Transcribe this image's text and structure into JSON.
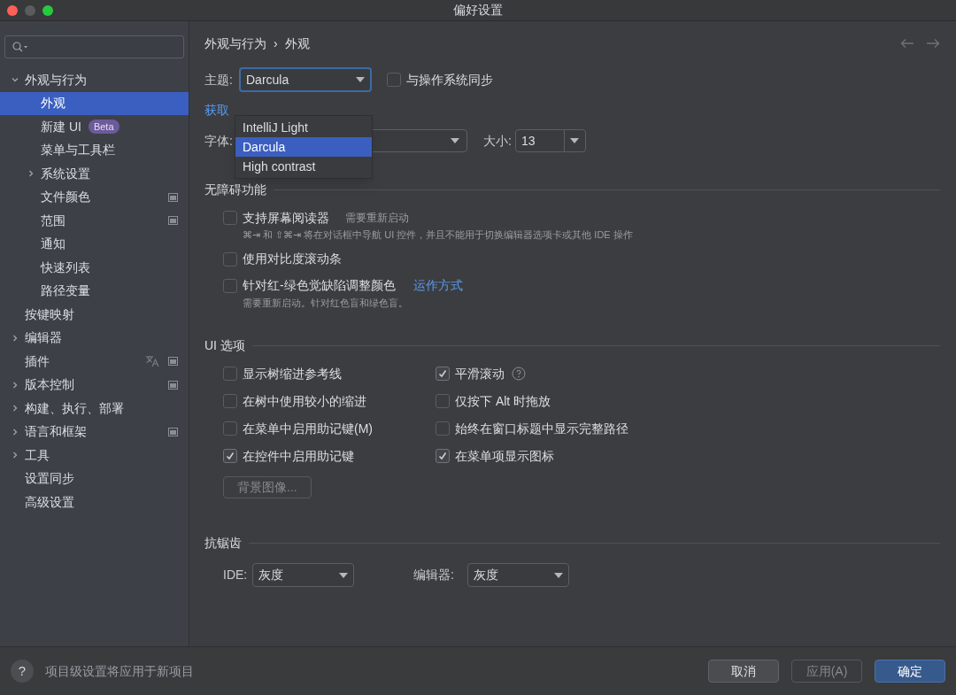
{
  "window": {
    "title": "偏好设置"
  },
  "sidebar": {
    "items": [
      {
        "label": "外观与行为",
        "selected": false,
        "expanded": true,
        "project_icon": false,
        "translate_icon": false,
        "children": [
          {
            "label": "外观",
            "selected": true,
            "project_icon": false,
            "translate_icon": false
          },
          {
            "label": "新建 UI",
            "badge": "Beta",
            "selected": false,
            "project_icon": false,
            "translate_icon": false
          },
          {
            "label": "菜单与工具栏",
            "selected": false,
            "project_icon": false,
            "translate_icon": false
          },
          {
            "label": "系统设置",
            "selected": false,
            "expanded": false,
            "project_icon": false,
            "translate_icon": false
          },
          {
            "label": "文件颜色",
            "selected": false,
            "project_icon": true,
            "translate_icon": false
          },
          {
            "label": "范围",
            "selected": false,
            "project_icon": true,
            "translate_icon": false
          },
          {
            "label": "通知",
            "selected": false,
            "project_icon": false,
            "translate_icon": false
          },
          {
            "label": "快速列表",
            "selected": false,
            "project_icon": false,
            "translate_icon": false
          },
          {
            "label": "路径变量",
            "selected": false,
            "project_icon": false,
            "translate_icon": false
          }
        ]
      },
      {
        "label": "按键映射",
        "selected": false,
        "project_icon": false,
        "translate_icon": false
      },
      {
        "label": "编辑器",
        "selected": false,
        "expanded": false,
        "project_icon": false,
        "translate_icon": false
      },
      {
        "label": "插件",
        "selected": false,
        "project_icon": true,
        "translate_icon": true
      },
      {
        "label": "版本控制",
        "selected": false,
        "expanded": false,
        "project_icon": true,
        "translate_icon": false
      },
      {
        "label": "构建、执行、部署",
        "selected": false,
        "expanded": false,
        "project_icon": false,
        "translate_icon": false
      },
      {
        "label": "语言和框架",
        "selected": false,
        "expanded": false,
        "project_icon": true,
        "translate_icon": false
      },
      {
        "label": "工具",
        "selected": false,
        "expanded": false,
        "project_icon": false,
        "translate_icon": false
      },
      {
        "label": "设置同步",
        "selected": false,
        "project_icon": false,
        "translate_icon": false
      },
      {
        "label": "高级设置",
        "selected": false,
        "project_icon": false,
        "translate_icon": false
      }
    ]
  },
  "breadcrumb": [
    "外观与行为",
    "›",
    "外观"
  ],
  "theme": {
    "label": "主题:",
    "value": "Darcula",
    "sync_label": "与操作系统同步",
    "sync_checked": false,
    "options": [
      {
        "label": "IntelliJ Light",
        "selected": false
      },
      {
        "label": "Darcula",
        "selected": true
      },
      {
        "label": "High contrast",
        "selected": false
      }
    ]
  },
  "more_link": "获取",
  "font": {
    "label": "字体:",
    "size_label": "大小:",
    "size": "13"
  },
  "accessibility": {
    "title": "无障碍功能",
    "options": [
      {
        "label": "支持屏幕阅读器",
        "checked": false,
        "note": "需要重新启动",
        "hint": "⌘⇥ 和 ⇧⌘⇥ 将在对话框中导航 UI 控件，并且不能用于切换编辑器选项卡或其他 IDE 操作"
      },
      {
        "label": "使用对比度滚动条",
        "checked": false
      },
      {
        "label": "针对红-绿色觉缺陷调整颜色",
        "checked": false,
        "link": "运作方式",
        "hint": "需要重新启动。针对红色盲和绿色盲。"
      }
    ]
  },
  "ui_options": {
    "title": "UI 选项",
    "left": [
      {
        "label": "显示树缩进参考线",
        "checked": false,
        "help": false
      },
      {
        "label": "在树中使用较小的缩进",
        "checked": false,
        "help": false
      },
      {
        "label": "在菜单中启用助记键(M)",
        "checked": false,
        "help": false
      },
      {
        "label": "在控件中启用助记键",
        "checked": true,
        "help": false
      }
    ],
    "right": [
      {
        "label": "平滑滚动",
        "checked": true,
        "help": true
      },
      {
        "label": "仅按下 Alt 时拖放",
        "checked": false,
        "help": false
      },
      {
        "label": "始终在窗口标题中显示完整路径",
        "checked": false,
        "help": false
      },
      {
        "label": "在菜单项显示图标",
        "checked": true,
        "help": false
      }
    ],
    "background_button": {
      "label": "背景图像...",
      "disabled": true
    }
  },
  "antialiasing": {
    "title": "抗锯齿",
    "ide_label": "IDE:",
    "ide_value": "灰度",
    "editor_label": "编辑器:",
    "editor_value": "灰度"
  },
  "footer": {
    "help": "?",
    "text": "项目级设置将应用于新项目",
    "buttons": [
      {
        "label": "取消",
        "kind": "normal",
        "disabled": false
      },
      {
        "label": "应用(A)",
        "kind": "normal",
        "disabled": true
      },
      {
        "label": "确定",
        "kind": "default",
        "disabled": false
      }
    ]
  }
}
